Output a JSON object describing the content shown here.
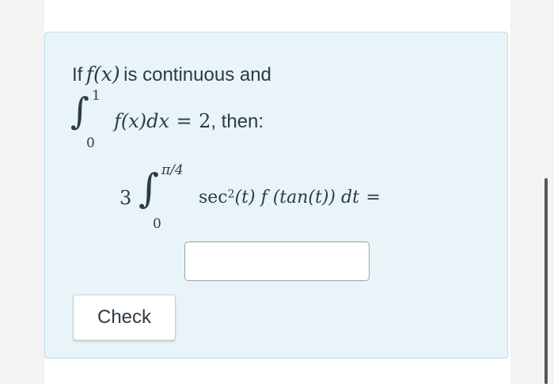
{
  "question": {
    "prompt_prefix": "If",
    "fx": "f(x)",
    "prompt_suffix": "is continuous and",
    "integral1": {
      "upper": "1",
      "lower": "0",
      "integrand": "f(x)dx",
      "equals": "=",
      "value": "2",
      "then_text": ", then:"
    },
    "integral2": {
      "coefficient": "3",
      "upper": "π/4",
      "lower": "0",
      "sec": "sec",
      "exponent": "2",
      "integrand_rest": "(t) f (tan(t)) dt",
      "equals": "="
    }
  },
  "answer": {
    "value": "",
    "placeholder": ""
  },
  "check_button": {
    "label": "Check"
  },
  "colors": {
    "card_background": "#e8f4f7",
    "card_border": "#bcdde7",
    "text": "#2d3b45",
    "page_side": "#f3f3f3"
  }
}
